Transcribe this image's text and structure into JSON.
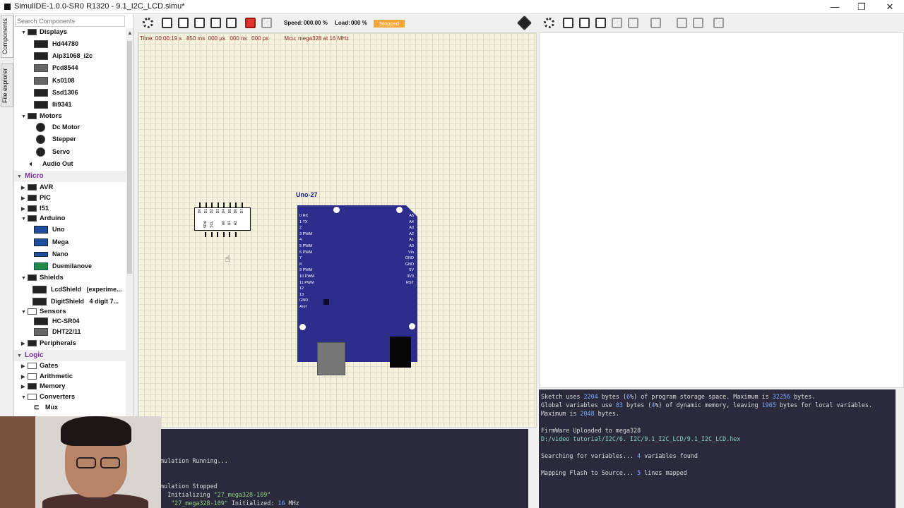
{
  "window": {
    "title": "SimulIDE-1.0.0-SR0 R1320 - 9.1_I2C_LCD.simu*",
    "minimize": "—",
    "maximize": "❐",
    "close": "✕"
  },
  "side_tabs": [
    "Components",
    "File explorer"
  ],
  "search": {
    "placeholder": "Search Components"
  },
  "tree": {
    "displays": {
      "label": "Displays",
      "items": [
        "Hd44780",
        "Aip31068_i2c",
        "Pcd8544",
        "Ks0108",
        "Ssd1306",
        "Ili9341"
      ]
    },
    "motors": {
      "label": "Motors",
      "items": [
        "Dc Motor",
        "Stepper",
        "Servo",
        "Audio Out"
      ]
    },
    "micro": {
      "label": "Micro"
    },
    "avr": "AVR",
    "pic": "PIC",
    "i51": "I51",
    "arduino": {
      "label": "Arduino",
      "items": [
        "Uno",
        "Mega",
        "Nano",
        "Duemilanove"
      ]
    },
    "shields": {
      "label": "Shields",
      "items": [
        "LcdShield",
        "(experime...",
        "DigitShield",
        "4 digit 7..."
      ]
    },
    "sensors": {
      "label": "Sensors",
      "items": [
        "HC-SR04",
        "DHT22/11"
      ]
    },
    "peripherals": "Peripherals",
    "logic": {
      "label": "Logic"
    },
    "gates": "Gates",
    "arithmetic": "Arithmetic",
    "memory": "Memory",
    "converters": {
      "label": "Converters",
      "items": [
        "Mux"
      ]
    }
  },
  "toolbar": {
    "speed_label": "Speed:",
    "speed_value": "000.00 %",
    "load_label": "Load:",
    "load_value": "000 %",
    "status": "Stopped"
  },
  "sim_time": "Time: 00:00:19 s   850 ms  000 µs   000 ns   000 ps          Mcu: mega328 at 16 MHz",
  "board": {
    "label": "Uno-27",
    "left_pins": [
      "0 RX",
      "1 TX",
      "2",
      "3 PWM",
      "4",
      "5 PWM",
      "6 PWM",
      "7",
      "",
      "8",
      "9 PWM",
      "10 PWM",
      "11 PWM",
      "12",
      "13",
      "GND",
      "Aref"
    ],
    "right_pins": [
      "A5",
      "A4",
      "A3",
      "A2",
      "A1",
      "A0",
      "",
      "Vin",
      "GND",
      "GND",
      "5V",
      "3V3",
      "RST"
    ]
  },
  "pcf": {
    "top_pins": [
      "D0",
      "D1",
      "D2",
      "D3",
      "D4",
      "D5",
      "D6",
      "D7"
    ],
    "bottom_pins": [
      "SDA",
      "SCL",
      "",
      "A0",
      "A1",
      "A2"
    ]
  },
  "console_right": {
    "l1a": "Sketch uses ",
    "l1b": "2204",
    "l1c": " bytes (",
    "l1d": "6",
    "l1e": "%) of program storage space. Maximum is ",
    "l1f": "32256",
    "l1g": " bytes.",
    "l2a": "Global variables use ",
    "l2b": "83",
    "l2c": " bytes (",
    "l2d": "4",
    "l2e": "%) of dynamic memory, leaving ",
    "l2f": "1965",
    "l2g": " bytes for local variables.",
    "l3a": "Maximum is ",
    "l3b": "2048",
    "l3c": " bytes.",
    "l4": "FirmWare Uploaded to mega328",
    "l5": "D:/video tutorial/I2C/6. I2C/9.1_I2C_LCD/9.1_I2C_LCD.hex",
    "l6a": "Searching for variables... ",
    "l6b": "4",
    "l6c": " variables found",
    "l7a": "Mapping Flash to Source... ",
    "l7b": "5",
    "l7c": " lines mapped"
  },
  "console_bottom": {
    "l1": "mulation Running...",
    "l2": "mulation Stopped",
    "l3a": "  Initializing ",
    "l3b": "\"27_mega328-109\"",
    "l4a": "   ",
    "l4b": "\"27_mega328-109\"",
    "l4c": " Initialized: ",
    "l4d": "16",
    "l4e": " MHz"
  }
}
